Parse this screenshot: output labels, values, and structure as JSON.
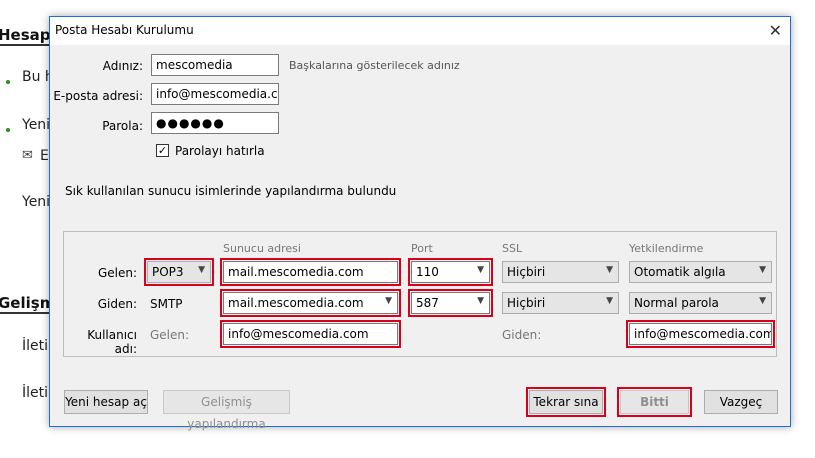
{
  "background": {
    "heading_1": "Hesapl",
    "items_1": [
      "Bu h",
      "Yeni",
      "E",
      "Yeni"
    ],
    "heading_2": "Gelişm",
    "items_2": [
      "İletil",
      "İleti"
    ]
  },
  "dialog": {
    "title": "Posta Hesabı Kurulumu",
    "close": "✕",
    "name_label": "Adınız:",
    "name_value": "mescomedia",
    "name_hint": "Başkalarına gösterilecek adınız",
    "email_label": "E-posta adresi:",
    "email_value": "info@mescomedia.com",
    "password_label": "Parola:",
    "password_value": "●●●●●●",
    "remember_label": "Parolayı hatırla",
    "remember_checked": "✓",
    "found_message": "Sık kullanılan sunucu isimlerinde yapılandırma bulundu",
    "headers": {
      "server": "Sunucu adresi",
      "port": "Port",
      "ssl": "SSL",
      "auth": "Yetkilendirme"
    },
    "incoming": {
      "label": "Gelen:",
      "protocol": "POP3",
      "server": "mail.mescomedia.com",
      "port": "110",
      "ssl": "Hiçbiri",
      "auth": "Otomatik algıla"
    },
    "outgoing": {
      "label": "Giden:",
      "protocol": "SMTP",
      "server": "mail.mescomedia.com",
      "port": "587",
      "ssl": "Hiçbiri",
      "auth": "Normal parola"
    },
    "username": {
      "label": "Kullanıcı adı:",
      "incoming_label": "Gelen:",
      "incoming_value": "info@mescomedia.com",
      "outgoing_label": "Giden:",
      "outgoing_value": "info@mescomedia.com"
    },
    "buttons": {
      "new_account": "Yeni hesap aç",
      "advanced": "Gelişmiş yapılandırma",
      "retest": "Tekrar sına",
      "done": "Bitti",
      "cancel": "Vazgeç"
    }
  }
}
